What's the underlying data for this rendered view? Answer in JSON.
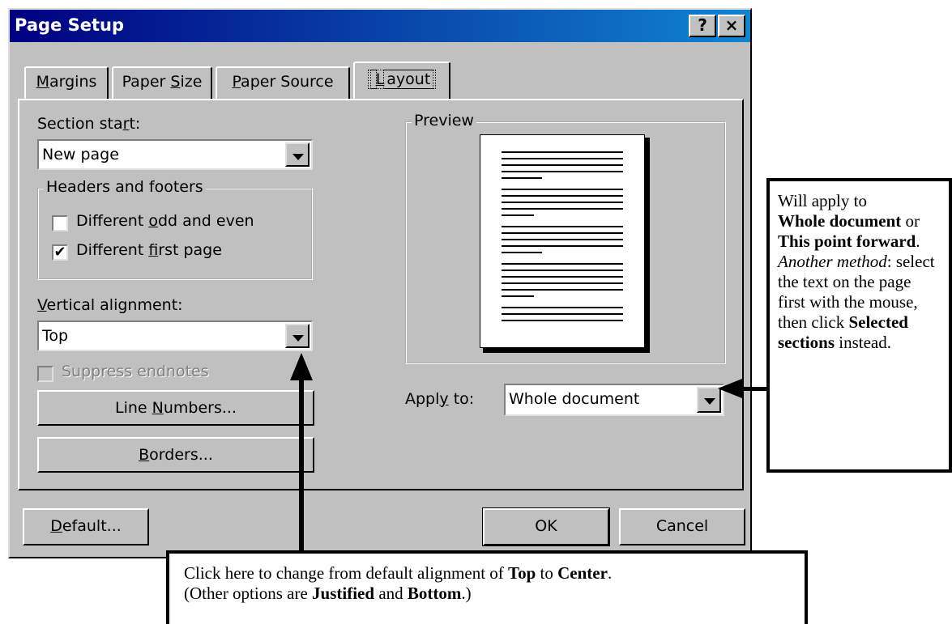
{
  "dialog": {
    "title": "Page Setup",
    "help_button": "?",
    "close_button": "×",
    "tabs": [
      {
        "pre": "",
        "u": "M",
        "post": "argins"
      },
      {
        "pre": "Paper ",
        "u": "S",
        "post": "ize"
      },
      {
        "pre": "",
        "u": "P",
        "post": "aper Source"
      },
      {
        "pre": "",
        "u": "L",
        "post": "ayout"
      }
    ],
    "active_tab": "Layout"
  },
  "layout": {
    "section_start": {
      "pre": "Section sta",
      "u": "r",
      "post": "t:",
      "value": "New page"
    },
    "headers_footers": {
      "title": "Headers and footers",
      "odd_even": {
        "pre": "Different ",
        "u": "o",
        "post": "dd and even",
        "checked": false
      },
      "first_page": {
        "pre": "Different ",
        "u": "f",
        "post": "irst page",
        "checked": true,
        "mark": "✔"
      }
    },
    "vertical_alignment": {
      "u": "V",
      "post": "ertical alignment:",
      "value": "Top"
    },
    "suppress_endnotes": {
      "label": "Suppress endnotes",
      "checked": false,
      "disabled": true
    },
    "line_numbers_button": {
      "pre": "Line ",
      "u": "N",
      "post": "umbers..."
    },
    "borders_button": {
      "pre": "",
      "u": "B",
      "post": "orders..."
    },
    "preview": {
      "title": "Preview"
    },
    "apply_to": {
      "pre": "Appl",
      "u": "y",
      "post": " to:",
      "value": "Whole document"
    }
  },
  "footer": {
    "default_button": {
      "u": "D",
      "post": "efault..."
    },
    "ok_button": "OK",
    "cancel_button": "Cancel"
  },
  "callouts": {
    "right": {
      "line1": "Will apply to",
      "b1": "Whole document",
      "t2": " or ",
      "b2": "This point forward",
      "t3": ".",
      "i1": "Another method",
      "t4": ": select the text on the page first with the mouse, then click ",
      "b3": "Selected sections",
      "t5": " instead."
    },
    "bottom": {
      "t1": "Click here to change from default alignment of ",
      "b1": "Top",
      "t2": " to ",
      "b2": "Center",
      "t3": ".",
      "t4": "(Other options are ",
      "b3": "Justified",
      "t5": " and ",
      "b4": "Bottom",
      "t6": ".)"
    }
  }
}
